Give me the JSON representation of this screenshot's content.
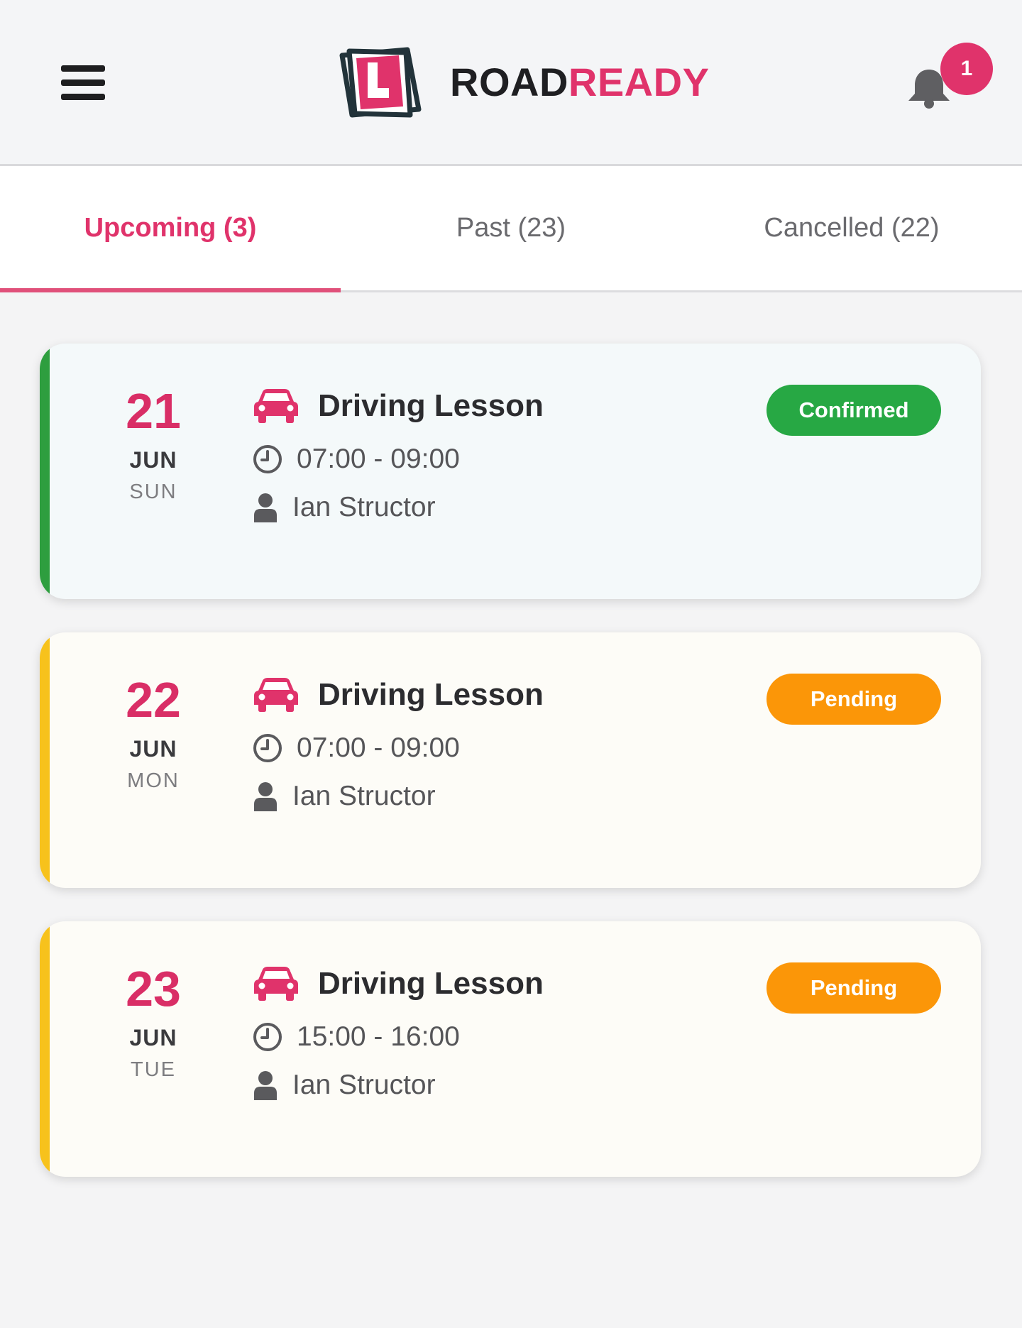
{
  "header": {
    "brand_part1": "ROAD",
    "brand_part2": "READY",
    "notification_count": "1"
  },
  "tabs": [
    {
      "label": "Upcoming (3)",
      "active": true
    },
    {
      "label": "Past (23)",
      "active": false
    },
    {
      "label": "Cancelled (22)",
      "active": false
    }
  ],
  "lessons": [
    {
      "day": "21",
      "month": "JUN",
      "weekday": "SUN",
      "title": "Driving Lesson",
      "time": "07:00 - 09:00",
      "instructor": "Ian Structor",
      "status": "Confirmed",
      "status_color": "#27a844",
      "accent_color": "#2e9e3f",
      "card_bg": "#f4f9fa"
    },
    {
      "day": "22",
      "month": "JUN",
      "weekday": "MON",
      "title": "Driving Lesson",
      "time": "07:00 - 09:00",
      "instructor": "Ian Structor",
      "status": "Pending",
      "status_color": "#fb9608",
      "accent_color": "#f7c21c",
      "card_bg": "#fdfcf7"
    },
    {
      "day": "23",
      "month": "JUN",
      "weekday": "TUE",
      "title": "Driving Lesson",
      "time": "15:00 - 16:00",
      "instructor": "Ian Structor",
      "status": "Pending",
      "status_color": "#fb9608",
      "accent_color": "#f7c21c",
      "card_bg": "#fdfcf7"
    }
  ],
  "colors": {
    "brand_pink": "#e0336b",
    "dark": "#1f1f22"
  },
  "icons": {
    "menu": "hamburger-icon",
    "notifications": "bell-icon",
    "lesson_type": "car-icon",
    "time": "clock-icon",
    "instructor": "person-icon"
  }
}
